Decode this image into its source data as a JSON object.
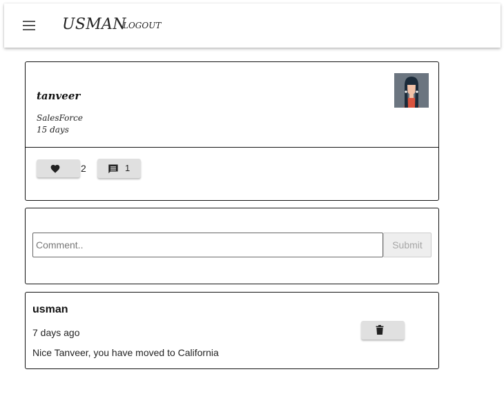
{
  "header": {
    "brand": "USMAN",
    "logout_label": "LOGOUT",
    "menu_icon": "hamburger-menu-icon"
  },
  "post": {
    "author": "tanveer",
    "company": "SalesForce",
    "time": "15 days",
    "avatar_icon": "woman-avatar",
    "likes": "2",
    "comments": "1",
    "like_icon": "heart-icon",
    "comment_icon": "comment-icon"
  },
  "comment_form": {
    "placeholder": "Comment..",
    "submit_label": "Submit"
  },
  "comments": [
    {
      "author": "usman",
      "time": "7 days ago",
      "text": "Nice Tanveer, you have moved to California",
      "delete_icon": "trash-icon"
    }
  ],
  "colors": {
    "button_bg": "#e0e0e0",
    "avatar_bg": "#6b7580",
    "avatar_shirt": "#d9533e",
    "border": "#111111"
  }
}
